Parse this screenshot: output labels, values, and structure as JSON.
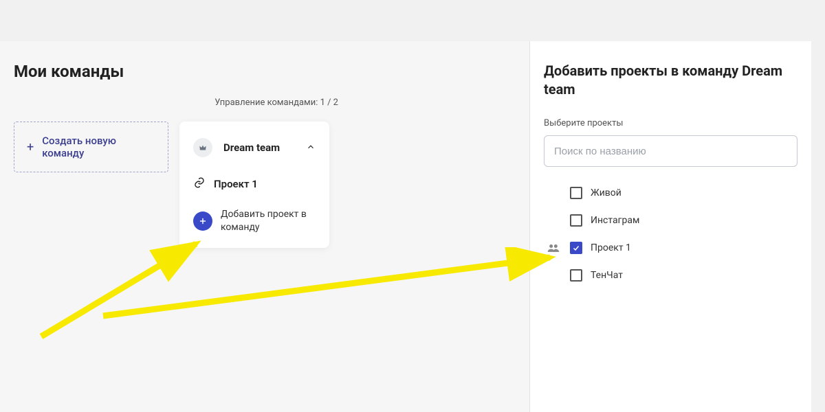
{
  "main": {
    "title": "Мои команды",
    "meta": "Управление командами: 1 / 2",
    "create_btn": "Создать новую команду",
    "team": {
      "name": "Dream team",
      "project": "Проект 1",
      "add_project": "Добавить проект в команду"
    }
  },
  "sidebar": {
    "title_prefix": "Добавить проекты в команду ",
    "title_team": "Dream team",
    "select_label": "Выберите проекты",
    "search_placeholder": "Поиск по названию",
    "projects": [
      {
        "label": "Живой",
        "checked": false,
        "has_team": false
      },
      {
        "label": "Инстаграм",
        "checked": false,
        "has_team": false
      },
      {
        "label": "Проект 1",
        "checked": true,
        "has_team": true
      },
      {
        "label": "ТенЧат",
        "checked": false,
        "has_team": false
      }
    ]
  }
}
